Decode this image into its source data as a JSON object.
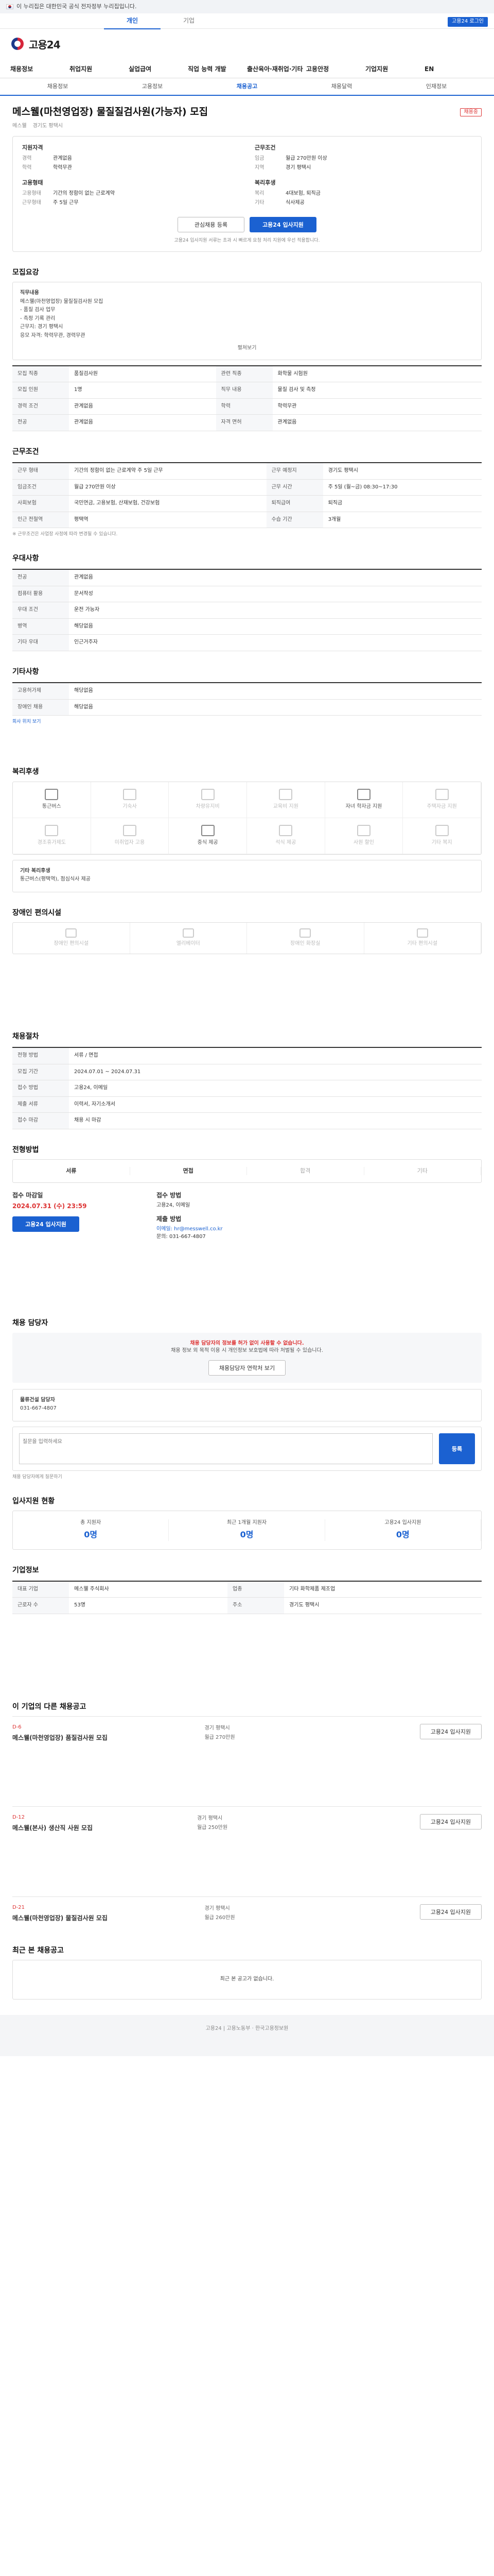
{
  "gov": {
    "text": "이 누리집은 대한민국 공식 전자정부 누리집입니다."
  },
  "subbar": {
    "tabs": [
      "개인",
      "기업"
    ],
    "login": "고용24 로그인"
  },
  "site": {
    "name": "고용24"
  },
  "gnb": [
    "채용정보",
    "취업지원",
    "실업급여",
    "직업 능력 개발",
    "출산육아·재취업·기타",
    "고용안정",
    "기업지원",
    "EN"
  ],
  "sub": [
    "채용정보",
    "고용정보",
    "채용공고",
    "채용달력",
    "인재정보"
  ],
  "title": {
    "main": "메스웰(마천영업장) 물질질검사원(가능자) 모집",
    "badge": "채용중",
    "org1": "메스웰",
    "org2": "경기도 평택시"
  },
  "summary": {
    "c1": {
      "h": "지원자격",
      "rows": [
        [
          "경력",
          "관계없음"
        ],
        [
          "학력",
          "학력무관"
        ]
      ]
    },
    "c2": {
      "h": "근무조건",
      "rows": [
        [
          "임금",
          "월급 270만원 이상"
        ],
        [
          "지역",
          "경기 평택시"
        ]
      ]
    },
    "c3": {
      "h": "고용형태",
      "rows": [
        [
          "고용형태",
          "기간의 정함이 없는 근로계약"
        ],
        [
          "근무형태",
          "주 5일 근무"
        ]
      ]
    },
    "c4": {
      "h": "복리후생",
      "rows": [
        [
          "복리",
          "4대보험, 퇴직금"
        ],
        [
          "기타",
          "식사제공"
        ]
      ]
    }
  },
  "buttons": {
    "scrap": "관심채용 등록",
    "apply": "고용24 입사지원"
  },
  "note1": "고용24 입사지원 서류는 초과 시 빠르게 요청 처리 지원에 우선 적용합니다.",
  "s_detail": {
    "h": "모집요강",
    "lines": [
      "직무내용",
      "메스웰(마천영업장) 물질질검사원 모집",
      "- 품질 검사 업무",
      "- 측정 기록 관리",
      "근무지: 경기 평택시",
      "응모 자격: 학력무관, 경력무관"
    ],
    "more": "펼쳐보기"
  },
  "s_info": {
    "rows": [
      [
        "모집 직종",
        "품질검사원"
      ],
      [
        "관련 직종",
        "화학물 시험원"
      ],
      [
        "모집 인원",
        "1명"
      ],
      [
        "직무 내용",
        "물질 검사 및 측정"
      ],
      [
        "경력 조건",
        "관계없음"
      ],
      [
        "학력",
        "학력무관"
      ],
      [
        "전공",
        "관계없음"
      ],
      [
        "자격 면허",
        "관계없음"
      ]
    ]
  },
  "s_cond": {
    "h": "근무조건",
    "rows": [
      [
        "근무 형태",
        "기간의 정함이 없는 근로계약 주 5일 근무"
      ],
      [
        "근무 예정지",
        "경기도 평택시"
      ],
      [
        "임금조건",
        "월급 270만원 이상"
      ],
      [
        "근무 시간",
        "주 5일 (월~금) 08:30~17:30"
      ],
      [
        "사회보험",
        "국민연금, 고용보험, 산재보험, 건강보험"
      ],
      [
        "퇴직급여",
        "퇴직금"
      ],
      [
        "인근 전철역",
        "평택역"
      ],
      [
        "수습 기간",
        "3개월"
      ]
    ],
    "note": "※ 근무조건은 사업장 사정에 따라 변경될 수 있습니다."
  },
  "s_prefer": {
    "h": "우대사항",
    "rows": [
      [
        "전공",
        "관계없음"
      ],
      [
        "컴퓨터 활용",
        "문서작성"
      ],
      [
        "우대 조건",
        "운전 가능자"
      ],
      [
        "병역",
        "해당없음"
      ],
      [
        "기타 우대",
        "인근거주자"
      ]
    ]
  },
  "s_etc": {
    "h": "기타사항",
    "rows": [
      [
        "고용허가제",
        "해당없음"
      ],
      [
        "장애인 채용",
        "해당없음"
      ]
    ],
    "link": "회사 위치 보기"
  },
  "s_welfare": {
    "h": "복리후생",
    "items": [
      "통근버스",
      "기숙사",
      "차량유지비",
      "교육비 지원",
      "자녀 학자금 지원",
      "주택자금 지원",
      "경조휴가제도",
      "미취업자 고용",
      "중식 제공",
      "석식 제공",
      "사원 할인",
      "기타 복지"
    ],
    "off": [
      1,
      2,
      3,
      5,
      6,
      7,
      9,
      10,
      11
    ],
    "note": "기타 복리후생",
    "note2": "통근버스(평택역), 점심식사 제공"
  },
  "s_disab": {
    "h": "장애인 편의시설",
    "items": [
      "장애인 편의시설",
      "엘리베이터",
      "장애인 화장실",
      "기타 편의시설"
    ]
  },
  "s_proc": {
    "h": "채용절차",
    "rows": [
      [
        "전형 방법",
        "서류 / 면접"
      ],
      [
        "모집 기간",
        "2024.07.01 ~ 2024.07.31"
      ],
      [
        "접수 방법",
        "고용24, 이메일"
      ],
      [
        "제출 서류",
        "이력서, 자기소개서"
      ],
      [
        "접수 마감",
        "채용 시 마감"
      ]
    ]
  },
  "s_step": {
    "h": "전형방법",
    "steps": [
      "서류",
      "면접",
      "합격",
      "기타"
    ]
  },
  "s_apply": {
    "d1": "접수 마감일",
    "d2": "2024.07.31 (수) 23:59",
    "d3": "접수 방법",
    "d4": "고용24, 이메일",
    "btn": "고용24 입사지원",
    "n1": "제출 방법",
    "n2": "이메일: hr@messwell.co.kr",
    "n3": "문의: 031-667-4807"
  },
  "s_contact": {
    "h": "채용 담당자",
    "warn": "채용 담당자의 정보를 허가 없이 사용할 수 없습니다.",
    "warn2": "채용 정보 외 목적 이용 시 개인정보 보호법에 따라 처벌될 수 있습니다.",
    "btn": "채용담당자 연락처 보기",
    "name": "물류건설 담당자",
    "tel": "031-667-4807",
    "qhint": "채용 담당자에게 질문하기",
    "qph": "질문을 입력하세요",
    "qbtn": "등록"
  },
  "s_stat": {
    "h": "입사지원 현황",
    "items": [
      [
        "총 지원자",
        "0명"
      ],
      [
        "최근 1개월 지원자",
        "0명"
      ],
      [
        "고용24 입사지원",
        "0명"
      ]
    ]
  },
  "s_company": {
    "h": "기업정보",
    "rows": [
      [
        "대표 기업",
        "메스웰 주식회사"
      ],
      [
        "업종",
        "기타 화학제품 제조업"
      ],
      [
        "근로자 수",
        "53명"
      ],
      [
        "주소",
        "경기도 평택시"
      ]
    ]
  },
  "s_jobs": {
    "h": "이 기업의 다른 채용공고",
    "items": [
      {
        "d": "D-6",
        "t": "메스웰(마천영업장) 품질검사원 모집",
        "m1": "경기 평택시",
        "m2": "월급 270만원",
        "b": "고용24 입사지원"
      },
      {
        "d": "D-12",
        "t": "메스웰(본사) 생산직 사원 모집",
        "m1": "경기 평택시",
        "m2": "월급 250만원",
        "b": "고용24 입사지원"
      },
      {
        "d": "D-21",
        "t": "메스웰(마천영업장) 물질검사원 모집",
        "m1": "경기 평택시",
        "m2": "월급 260만원",
        "b": "고용24 입사지원"
      }
    ]
  },
  "s_recent": {
    "h": "최근 본 채용공고",
    "empty": "최근 본 공고가 없습니다."
  },
  "footer": "고용24 | 고용노동부 · 한국고용정보원"
}
